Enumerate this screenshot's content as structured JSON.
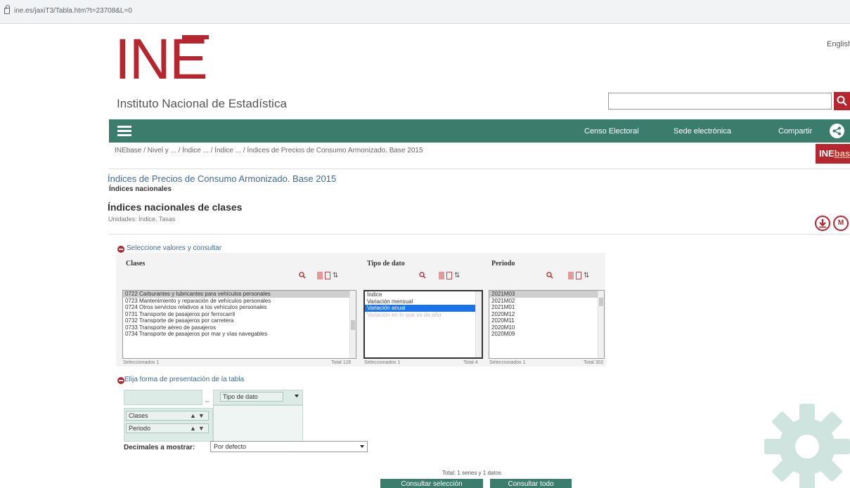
{
  "browser": {
    "url": "ine.es/jaxiT3/Tabla.htm?t=23708&L=0"
  },
  "header": {
    "logo_text": "INE",
    "subtitle": "Instituto Nacional de Estadística",
    "lang_link": "English",
    "search_placeholder": ""
  },
  "nav": {
    "links": [
      "Censo Electoral",
      "Sede electrónica",
      "Compartir"
    ]
  },
  "breadcrumb": "INEbase / Nivel y ... / Índice ... / Índice ... / Índices de Precios de Consumo Armonizado. Base 2015",
  "inebase_badge": {
    "ine": "INE",
    "base": "base"
  },
  "page": {
    "title": "Índices de Precios de Consumo Armonizado. Base 2015",
    "subtitle": "Índices nacionales",
    "table_title": "Índices nacionales de clases",
    "units": "Unidades: Índice, Tasas"
  },
  "selection": {
    "panel_title": "Seleccione valores y consultar",
    "variables": [
      {
        "name": "Clases",
        "options": [
          "0722 Carburantes y lubricantes para vehículos personales",
          "0723 Mantenimiento y reparación de vehículos personales",
          "0724 Otros servicios relativos a los vehículos personales",
          "0731 Transporte de pasajeros por ferrocarril",
          "0732 Transporte de pasajeros por carretera",
          "0733 Transporte aéreo de pasajeros",
          "0734 Transporte de pasajeros por mar y vías navegables"
        ],
        "selected_index": 0,
        "footer_left": "Seleccionados 1",
        "footer_right": "Total 126"
      },
      {
        "name": "Tipo de dato",
        "options": [
          "Índice",
          "Variación mensual",
          "Variación anual",
          "Variación en lo que va de año"
        ],
        "selected_index": 2,
        "footer_left": "Seleccionados 1",
        "footer_right": "Total 4"
      },
      {
        "name": "Periodo",
        "options": [
          "2021M03",
          "2021M02",
          "2021M01",
          "2020M12",
          "2020M11",
          "2020M10",
          "2020M09"
        ],
        "selected_index": 0,
        "footer_left": "Seleccionados 1",
        "footer_right": "Total 302"
      }
    ]
  },
  "layout": {
    "title": "Elija forma de presentación de la tabla",
    "column_var": "Tipo de dato",
    "row_vars": [
      "Clases",
      "Periodo"
    ],
    "decimals_label": "Decimales a mostrar:",
    "decimals_value": "Por defecto"
  },
  "footer": {
    "total": "Total: 1 series y 1 datos",
    "btn_consult_selection": "Consultar selección",
    "btn_consult_all": "Consultar todo"
  },
  "colors": {
    "brand_red": "#b5262f",
    "nav_green": "#3b7d6c",
    "link_blue": "#3f6a92"
  }
}
